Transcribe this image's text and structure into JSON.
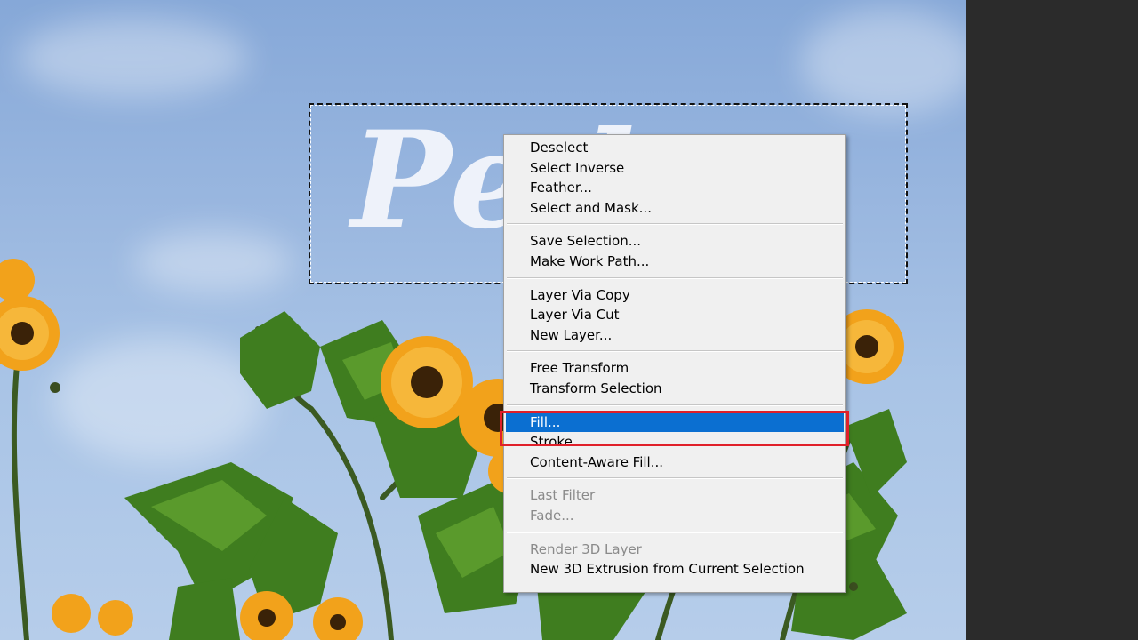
{
  "canvas": {
    "logo_text": "Pe                   l"
  },
  "context_menu": {
    "groups": [
      [
        {
          "label": "Deselect",
          "enabled": true
        },
        {
          "label": "Select Inverse",
          "enabled": true
        },
        {
          "label": "Feather...",
          "enabled": true
        },
        {
          "label": "Select and Mask...",
          "enabled": true
        }
      ],
      [
        {
          "label": "Save Selection...",
          "enabled": true
        },
        {
          "label": "Make Work Path...",
          "enabled": true
        }
      ],
      [
        {
          "label": "Layer Via Copy",
          "enabled": true
        },
        {
          "label": "Layer Via Cut",
          "enabled": true
        },
        {
          "label": "New Layer...",
          "enabled": true
        }
      ],
      [
        {
          "label": "Free Transform",
          "enabled": true
        },
        {
          "label": "Transform Selection",
          "enabled": true
        }
      ],
      [
        {
          "label": "Fill...",
          "enabled": true,
          "highlighted": true
        },
        {
          "label": "Stroke...",
          "enabled": true
        },
        {
          "label": "Content-Aware Fill...",
          "enabled": true
        }
      ],
      [
        {
          "label": "Last Filter",
          "enabled": false
        },
        {
          "label": "Fade...",
          "enabled": false
        }
      ],
      [
        {
          "label": "Render 3D Layer",
          "enabled": false
        },
        {
          "label": "New 3D Extrusion from Current Selection",
          "enabled": true
        }
      ]
    ]
  },
  "colors": {
    "highlight": "#0b6fd1",
    "annotation_box": "#e0202a",
    "panel_dark": "#2b2b2b"
  }
}
